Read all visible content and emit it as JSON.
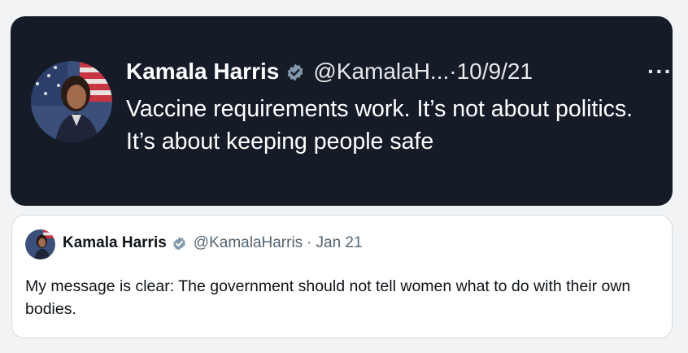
{
  "tweet": {
    "author_name": "Kamala Harris",
    "handle": "@KamalaH...",
    "separator": "·",
    "date": "10/9/21",
    "more_label": "···",
    "text": "Vaccine requirements work. It’s not about politics. It’s about keeping people safe"
  },
  "quoted_tweet": {
    "author_name": "Kamala Harris",
    "handle": "@KamalaHarris",
    "separator": "·",
    "date": "Jan 21",
    "text": "My message is clear: The government should not tell women what to do with their own bodies."
  },
  "colors": {
    "dark_card": "#151c28",
    "verified_badge": "#829aab",
    "page_background": "#f2f3f5"
  },
  "icons": {
    "verified": "verified-badge-icon",
    "more": "more-options-icon"
  }
}
